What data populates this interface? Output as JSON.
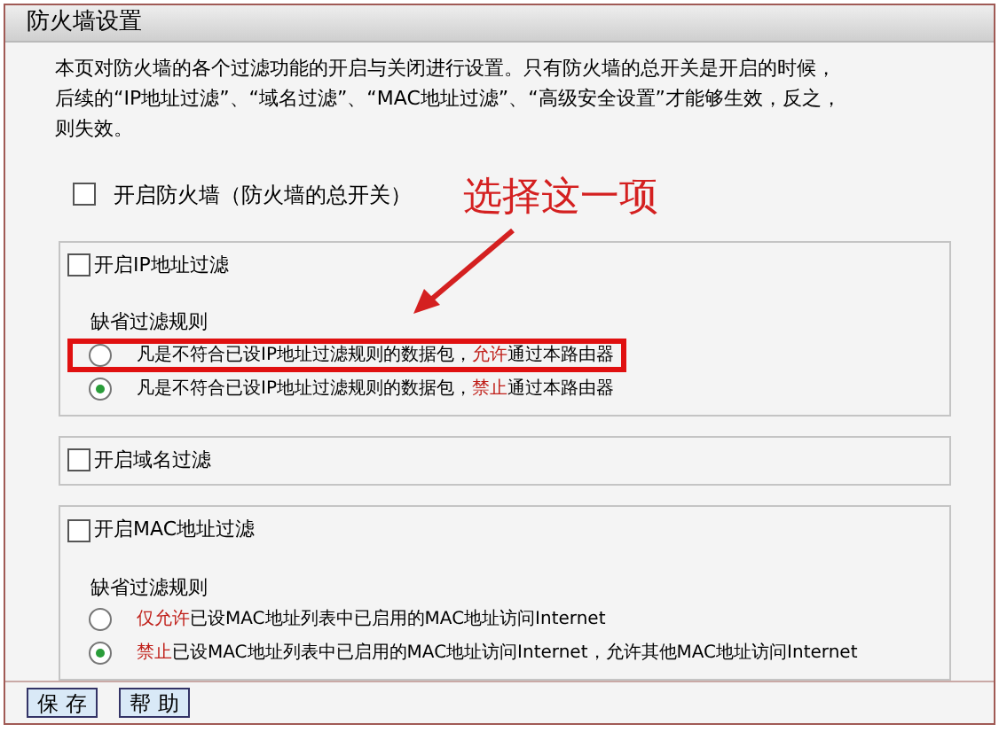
{
  "window": {
    "title": "防火墙设置"
  },
  "description": "本页对防火墙的各个过滤功能的开启与关闭进行设置。只有防火墙的总开关是开启的时候，后续的“IP地址过滤”、“域名过滤”、“MAC地址过滤”、“高级安全设置”才能够生效，反之，则失效。",
  "master_switch": {
    "label": "开启防火墙（防火墙的总开关）",
    "checked": false
  },
  "annotation": {
    "text": "选择这一项"
  },
  "sections": [
    {
      "label": "开启IP地址过滤",
      "checked": false,
      "rules_title": "缺省过滤规则",
      "rules": [
        {
          "before": "凡是不符合已设IP地址过滤规则的数据包，",
          "highlight": "允许",
          "after": "通过本路由器",
          "selected": false,
          "highlighted": true
        },
        {
          "before": "凡是不符合已设IP地址过滤规则的数据包，",
          "highlight": "禁止",
          "after": "通过本路由器",
          "selected": true,
          "highlighted": false
        }
      ]
    },
    {
      "label": "开启域名过滤",
      "checked": false
    },
    {
      "label": "开启MAC地址过滤",
      "checked": false,
      "rules_title": "缺省过滤规则",
      "rules": [
        {
          "highlight": "仅允许",
          "after": "已设MAC地址列表中已启用的MAC地址访问Internet",
          "selected": false,
          "highlighted": false
        },
        {
          "highlight": "禁止",
          "after": "已设MAC地址列表中已启用的MAC地址访问Internet，允许其他MAC地址访问Internet",
          "selected": true,
          "highlighted": false
        }
      ]
    }
  ],
  "buttons": [
    "保 存",
    "帮 助"
  ]
}
